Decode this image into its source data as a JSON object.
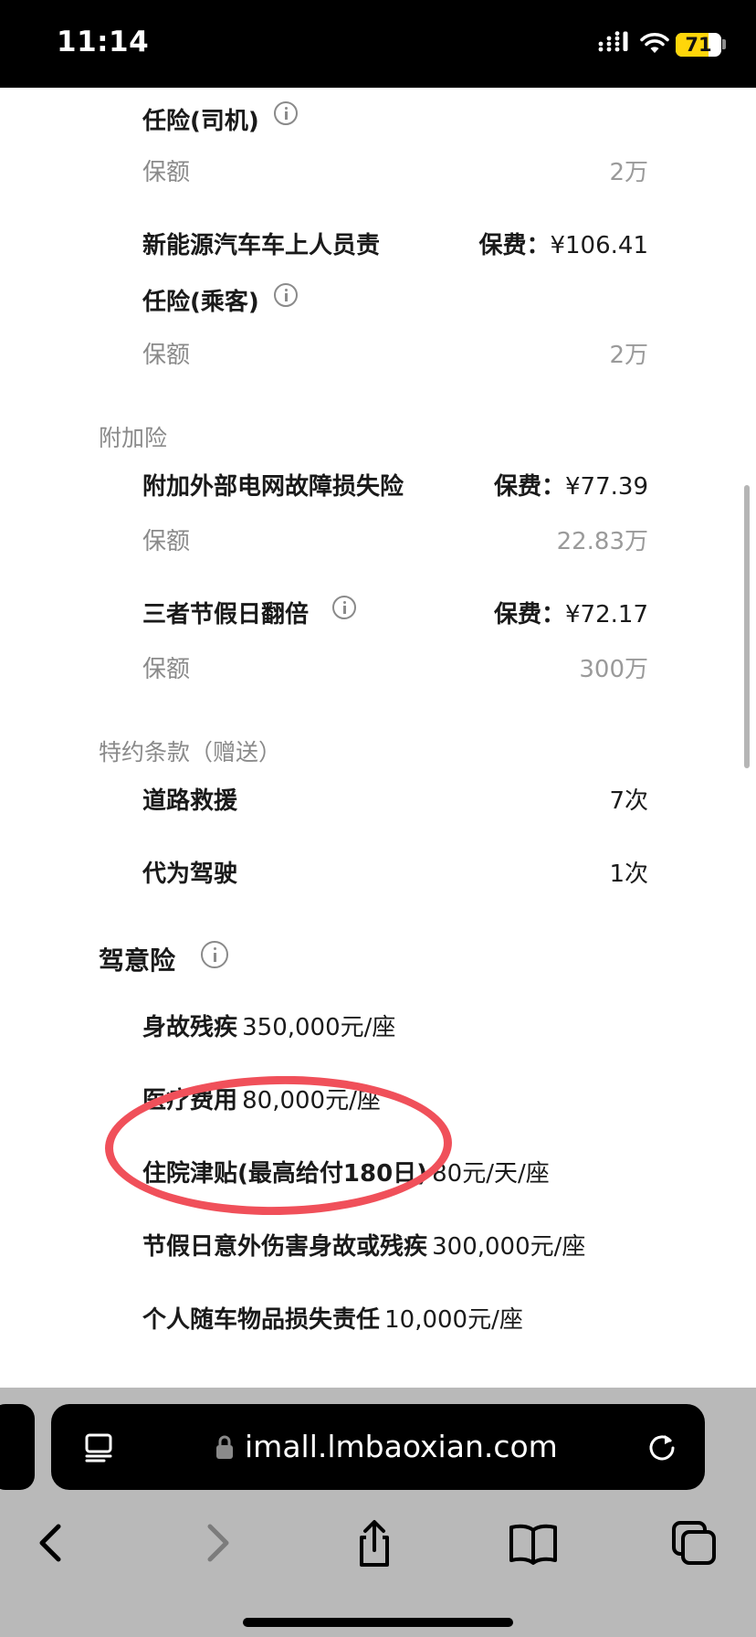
{
  "status_bar": {
    "time": "11:14",
    "battery_level": 71,
    "battery_color": "#ffd60a"
  },
  "coverage": {
    "driver_liability": {
      "title_line2": "任险(司机)",
      "amount_label": "保额",
      "amount": "2万"
    },
    "passenger_liability": {
      "title_line1": "新能源汽车车上人员责",
      "title_line2": "任险(乘客)",
      "premium_label": "保费：",
      "premium": "¥106.41",
      "amount_label": "保额",
      "amount": "2万"
    }
  },
  "addons": {
    "heading": "附加险",
    "items": [
      {
        "name": "附加外部电网故障损失险",
        "premium_label": "保费：",
        "premium": "¥77.39",
        "amount_label": "保额",
        "amount": "22.83万"
      },
      {
        "name": "三者节假日翻倍",
        "premium_label": "保费：",
        "premium": "¥72.17",
        "amount_label": "保额",
        "amount": "300万"
      }
    ]
  },
  "special_terms": {
    "heading": "特约条款（赠送）",
    "items": [
      {
        "name": "道路救援",
        "value": "7次"
      },
      {
        "name": "代为驾驶",
        "value": "1次"
      }
    ]
  },
  "accident": {
    "heading": "驾意险",
    "items": [
      {
        "name": "身故残疾",
        "value": "350,000元/座"
      },
      {
        "name": "医疗费用",
        "value": "80,000元/座"
      },
      {
        "name": "住院津贴(最高给付180日)",
        "value": "80元/天/座"
      },
      {
        "name": "节假日意外伤害身故或残疾",
        "value": "300,000元/座"
      },
      {
        "name": "个人随车物品损失责任",
        "value": "10,000元/座"
      }
    ],
    "highlight_color": "#f0505a"
  },
  "browser": {
    "url": "imall.lmbaoxian.com"
  }
}
